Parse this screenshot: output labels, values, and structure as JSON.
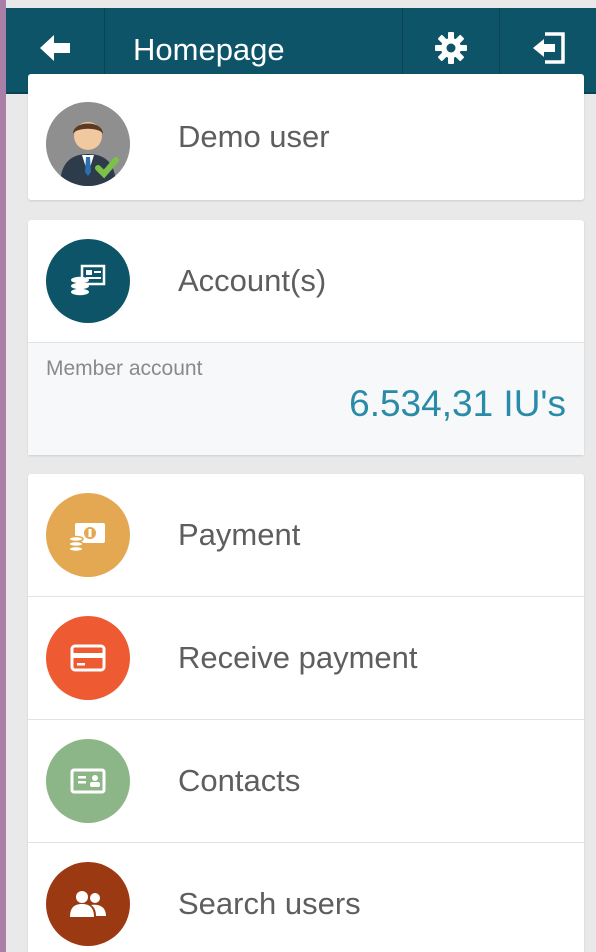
{
  "header": {
    "title": "Homepage",
    "back_icon": "arrow-left-icon",
    "settings_icon": "gear-icon",
    "logout_icon": "logout-icon",
    "color": "#0d5468"
  },
  "user": {
    "name": "Demo user",
    "avatar_icon": "user-avatar-icon"
  },
  "accounts": {
    "label": "Account(s)",
    "icon": "account-icon",
    "color": "#0d5468",
    "items": [
      {
        "name": "Member account",
        "balance": "6.534,31 IU's"
      }
    ]
  },
  "menu": [
    {
      "label": "Payment",
      "icon": "payment-icon",
      "color": "#e3a851"
    },
    {
      "label": "Receive payment",
      "icon": "card-icon",
      "color": "#ee5a32"
    },
    {
      "label": "Contacts",
      "icon": "contacts-icon",
      "color": "#8db688"
    },
    {
      "label": "Search users",
      "icon": "users-icon",
      "color": "#9b3a12"
    }
  ]
}
